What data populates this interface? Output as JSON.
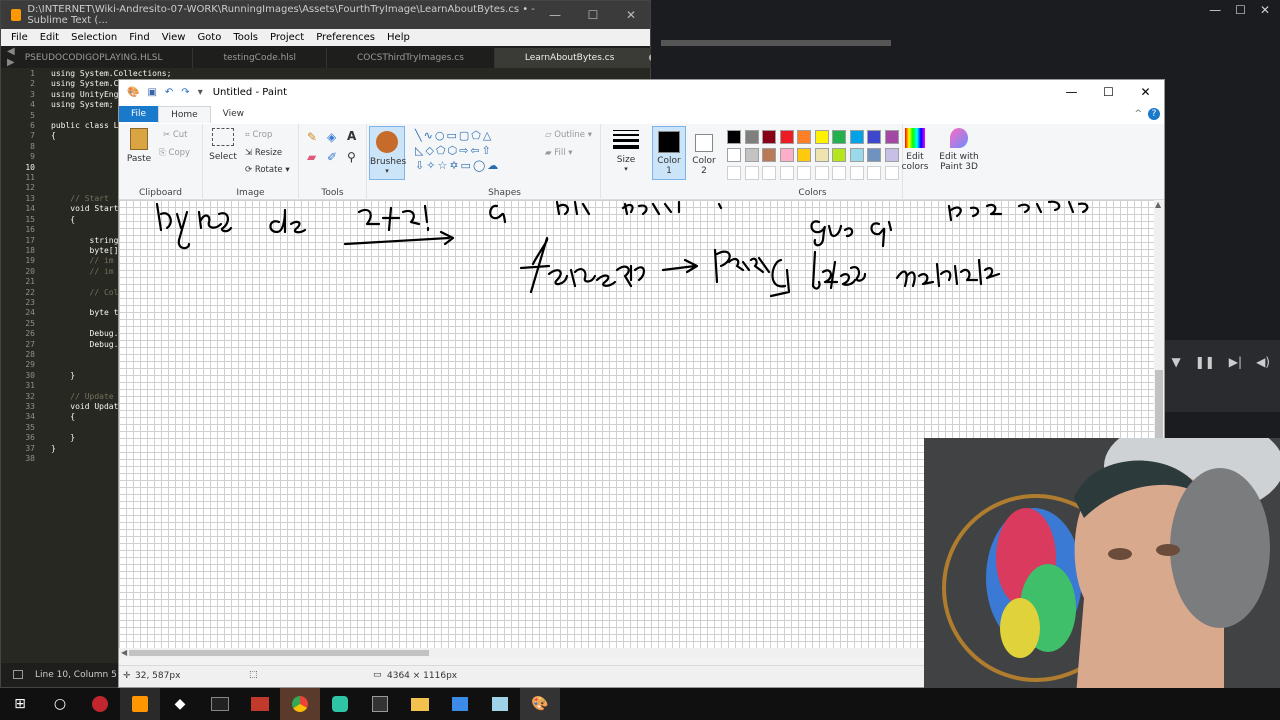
{
  "sublime": {
    "title": "D:\\INTERNET\\Wiki-Andresito-07-WORK\\RunningImages\\Assets\\FourthTryImage\\LearnAboutBytes.cs • - Sublime Text (...",
    "menu": [
      "File",
      "Edit",
      "Selection",
      "Find",
      "View",
      "Goto",
      "Tools",
      "Project",
      "Preferences",
      "Help"
    ],
    "tabs": [
      "PSEUDOCODIGOPLAYING.HLSL",
      "testingCode.hlsl",
      "COCSThirdTryImages.cs",
      "LearnAboutBytes.cs"
    ],
    "line_numbers": [
      "1",
      "2",
      "3",
      "4",
      "5",
      "6",
      "7",
      "8",
      "9",
      "10",
      "11",
      "12",
      "13",
      "14",
      "15",
      "16",
      "17",
      "18",
      "19",
      "20",
      "21",
      "22",
      "23",
      "24",
      "25",
      "26",
      "27",
      "28",
      "29",
      "30",
      "31",
      "32",
      "33",
      "34",
      "35",
      "36",
      "37",
      "38"
    ],
    "code": {
      "l1": "using System.Collections;",
      "l2": "using System.C",
      "l3": "using UnityEng",
      "l4": "using System;",
      "l6": "public class L",
      "l7": "{",
      "l13": "    // Start",
      "l14": "    void Start",
      "l15": "    {",
      "l17": "        string",
      "l18": "        byte[]",
      "l19": "        // im",
      "l20": "        // im",
      "l22": "        // Col",
      "l24": "        byte t",
      "l26": "        Debug.",
      "l27": "        Debug.",
      "l30": "    }",
      "l32": "    // Update",
      "l33": "    void Updat",
      "l34": "    {",
      "l36": "    }",
      "l37": "}"
    },
    "status": "Line 10, Column 5"
  },
  "paint": {
    "title": "Untitled - Paint",
    "tabs": {
      "file": "File",
      "home": "Home",
      "view": "View"
    },
    "clipboard": {
      "paste": "Paste",
      "cut": "Cut",
      "copy": "Copy",
      "label": "Clipboard"
    },
    "image": {
      "select": "Select",
      "crop": "Crop",
      "resize": "Resize",
      "rotate": "Rotate",
      "label": "Image"
    },
    "tools": {
      "label": "Tools"
    },
    "brushes": "Brushes",
    "shapes": {
      "outline": "Outline",
      "fill": "Fill",
      "label": "Shapes"
    },
    "size": "Size",
    "color1": "Color 1",
    "color2": "Color 2",
    "colors_label": "Colors",
    "edit_colors": "Edit colors",
    "edit_paint3d": "Edit with Paint 3D",
    "status": {
      "position": "32, 587px",
      "dimensions": "4364 × 1116px"
    }
  },
  "palette_row1": [
    "#000000",
    "#7f7f7f",
    "#880015",
    "#ed1c24",
    "#ff7f27",
    "#fff200",
    "#22b14c",
    "#00a2e8",
    "#3f48cc",
    "#a349a4"
  ],
  "palette_row2": [
    "#ffffff",
    "#c3c3c3",
    "#b97a57",
    "#ffaec9",
    "#ffc90e",
    "#efe4b0",
    "#b5e61d",
    "#99d9ea",
    "#7092be",
    "#c8bfe7"
  ],
  "colors": {
    "accent": "#1979ca",
    "sublime_bg": "#272822",
    "canvas_grid": "#d0d0d0"
  }
}
